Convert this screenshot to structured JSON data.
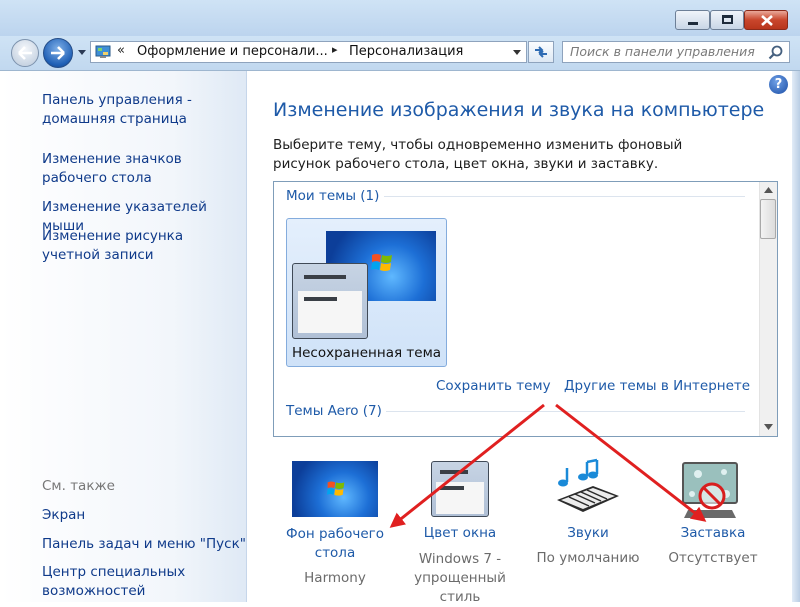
{
  "address": {
    "chevrons": "«",
    "crumb1": "Оформление и персонали...",
    "separator": "▸",
    "crumb2": "Персонализация"
  },
  "search": {
    "placeholder": "Поиск в панели управления"
  },
  "sidebar": {
    "home": "Панель управления - домашняя страница",
    "links": [
      "Изменение значков рабочего стола",
      "Изменение указателей мыши",
      "Изменение рисунка учетной записи"
    ],
    "see_also_title": "См. также",
    "see_also": [
      "Экран",
      "Панель задач и меню \"Пуск\"",
      "Центр специальных возможностей"
    ]
  },
  "main": {
    "title": "Изменение изображения и звука на компьютере",
    "description": "Выберите тему, чтобы одновременно изменить фоновый рисунок рабочего стола, цвет окна, звуки и заставку.",
    "my_themes": "Мои темы (1)",
    "unsaved_theme": "Несохраненная тема",
    "save_theme": "Сохранить тему",
    "more_themes": "Другие темы в Интернете",
    "aero_themes": "Темы Aero (7)"
  },
  "bottom": {
    "background_label": "Фон рабочего стола",
    "background_value": "Harmony",
    "color_label": "Цвет окна",
    "color_value": "Windows 7 - упрощенный стиль",
    "sounds_label": "Звуки",
    "sounds_value": "По умолчанию",
    "screensaver_label": "Заставка",
    "screensaver_value": "Отсутствует"
  },
  "colors": {
    "link": "#1e5aa8",
    "heading": "#1e5aa8",
    "annotation_arrow": "#e02020"
  },
  "icons": [
    "back-arrow-icon",
    "forward-arrow-icon",
    "control-panel-icon",
    "refresh-icon",
    "search-icon",
    "help-icon"
  ]
}
